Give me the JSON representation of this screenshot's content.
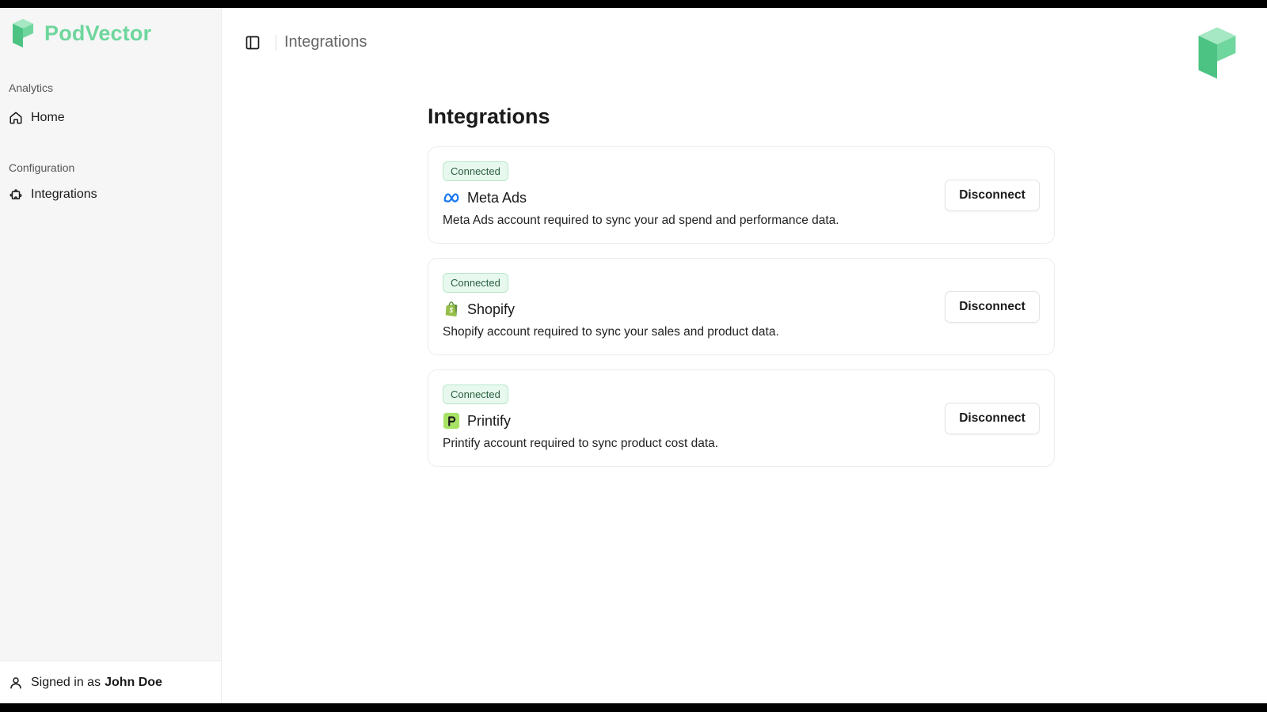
{
  "app": {
    "brand_name": "PodVector",
    "brand_color": "#6fd69d"
  },
  "sidebar": {
    "groups": [
      {
        "label": "Analytics",
        "items": [
          {
            "label": "Home",
            "icon": "home-icon"
          }
        ]
      },
      {
        "label": "Configuration",
        "items": [
          {
            "label": "Integrations",
            "icon": "puzzle-icon"
          }
        ]
      }
    ],
    "footer": {
      "prefix": "Signed in as",
      "user": "John Doe",
      "icon": "user-icon"
    }
  },
  "header": {
    "breadcrumb": "Integrations",
    "toggle_icon": "sidebar-toggle-icon"
  },
  "main": {
    "title": "Integrations",
    "integrations": [
      {
        "status": "Connected",
        "name": "Meta Ads",
        "icon": "meta-icon",
        "description": "Meta Ads account required to sync your ad spend and performance data.",
        "action": "Disconnect"
      },
      {
        "status": "Connected",
        "name": "Shopify",
        "icon": "shopify-icon",
        "description": "Shopify account required to sync your sales and product data.",
        "action": "Disconnect"
      },
      {
        "status": "Connected",
        "name": "Printify",
        "icon": "printify-icon",
        "description": "Printify account required to sync product cost data.",
        "action": "Disconnect"
      }
    ]
  },
  "colors": {
    "badge_bg": "#e7f8ee",
    "badge_border": "#b9e8cb",
    "sidebar_bg": "#f6f6f6"
  }
}
